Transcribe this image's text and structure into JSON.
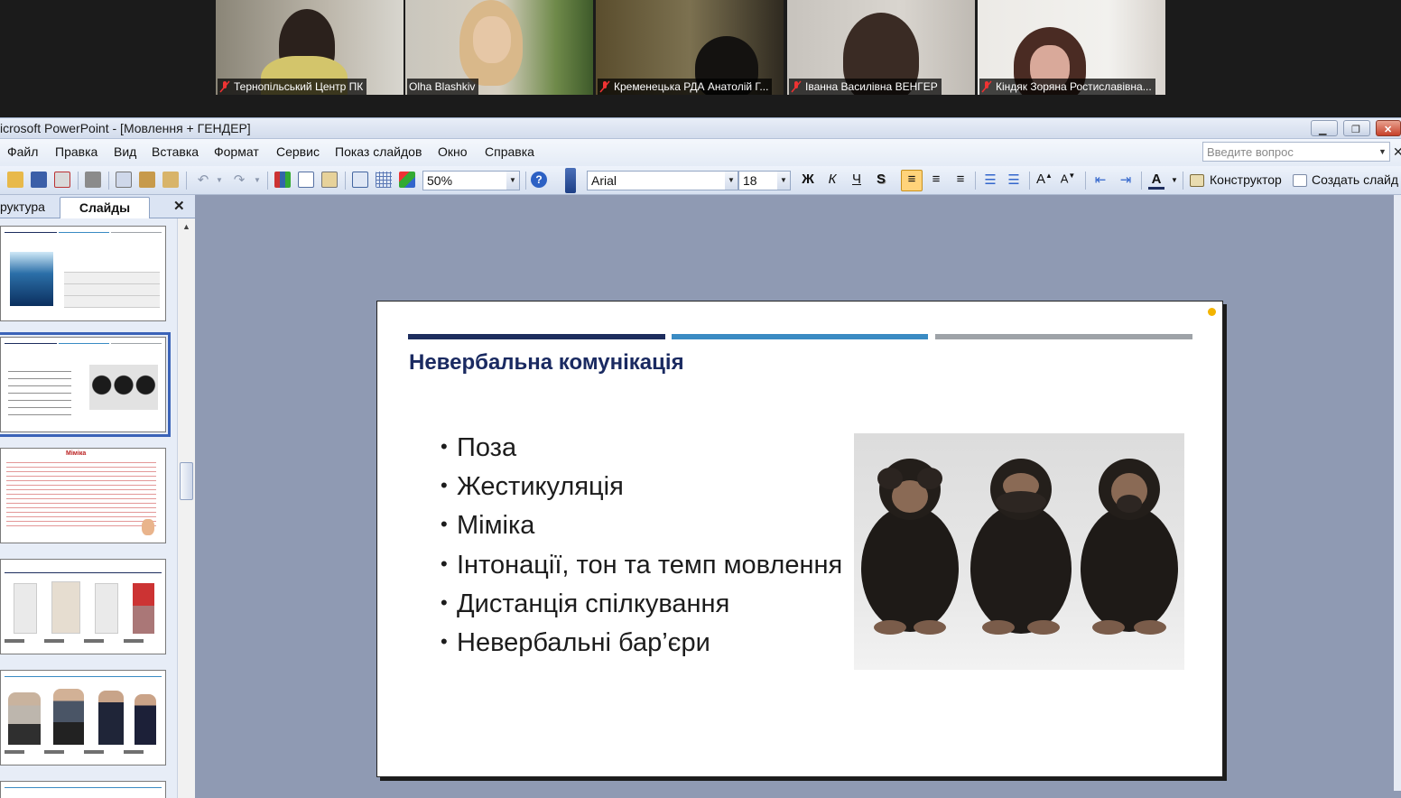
{
  "video": {
    "participants": [
      {
        "name": "Тернопільський Центр ПК",
        "muted": true
      },
      {
        "name": "Olha Blashkiv",
        "muted": false
      },
      {
        "name": "Кременецька РДА Анатолій Г...",
        "muted": true
      },
      {
        "name": "Іванна Василівна ВЕНГЕР",
        "muted": true
      },
      {
        "name": "Кіндяк Зоряна Ростиславівна...",
        "muted": true
      }
    ]
  },
  "window": {
    "title": "icrosoft PowerPoint - [Мовлення + ГЕНДЕР]"
  },
  "menu": {
    "items": [
      "Файл",
      "Правка",
      "Вид",
      "Вставка",
      "Формат",
      "Сервис",
      "Показ слайдов",
      "Окно",
      "Справка"
    ],
    "ask_placeholder": "Введите вопрос"
  },
  "toolbar": {
    "zoom": "50%",
    "font": "Arial",
    "size": "18",
    "bold": "Ж",
    "italic": "К",
    "underline": "Ч",
    "shadow": "S",
    "designer": "Конструктор",
    "new_slide": "Создать слайд"
  },
  "leftpane": {
    "tab_outline": "руктура",
    "tab_slides": "Слайды",
    "thumb3_title": "Міміка"
  },
  "slide": {
    "title": "Невербальна комунікація",
    "bullets": [
      "Поза",
      "Жестикуляція",
      "Міміка",
      "Інтонації, тон та темп мовлення",
      "Дистанція спілкування",
      "Невербальні бар’єри"
    ]
  },
  "colors": {
    "bar1": "#1d2d5e",
    "bar2": "#3a8bc3",
    "bar3": "#9ea3a8",
    "title": "#1a2a61"
  }
}
